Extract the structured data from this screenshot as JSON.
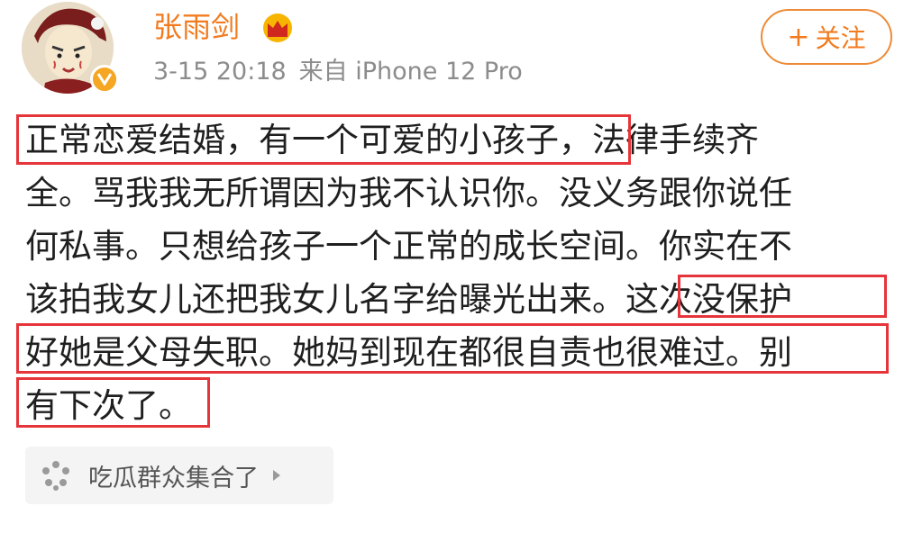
{
  "user": {
    "name": "张雨剑",
    "timestamp": "3-15 20:18",
    "source": "来自 iPhone 12 Pro",
    "follow_label": "关注",
    "follow_plus": "+"
  },
  "post": {
    "lines": [
      "正常恋爱结婚，有一个可爱的小孩子，法律手续齐",
      "全。骂我我无所谓因为我不认识你。没义务跟你说任",
      "何私事。只想给孩子一个正常的成长空间。你实在不",
      "该拍我女儿还把我女儿名字给曝光出来。这次没保护",
      "好她是父母失职。她妈到现在都很自责也很难过。别",
      "有下次了。"
    ]
  },
  "topic": {
    "label": "吃瓜群众集合了"
  },
  "colors": {
    "username": "#f27b1f",
    "meta": "#8c8c8c",
    "highlight_box": "#e6353a",
    "verified_badge": "#f5a623"
  },
  "icons": [
    "avatar-image",
    "verified-badge-icon",
    "crown-icon",
    "topic-dots-icon",
    "chevron-right-icon"
  ]
}
